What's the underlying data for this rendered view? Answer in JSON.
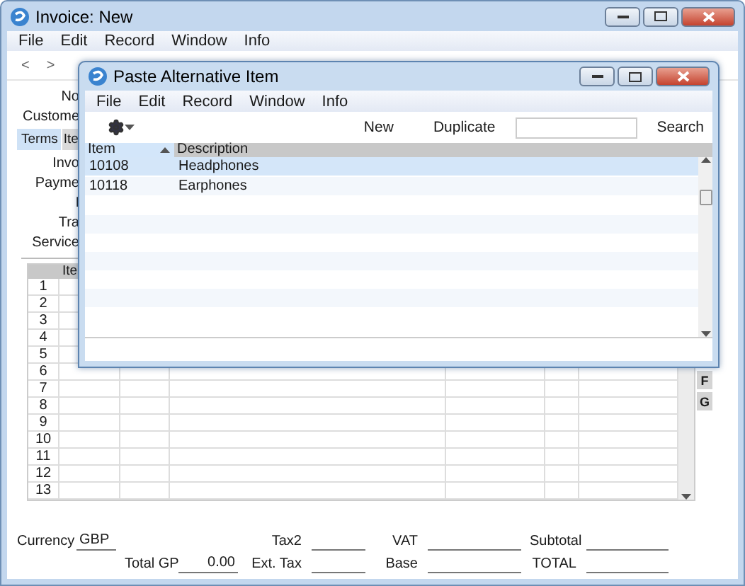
{
  "main_window": {
    "title": "Invoice: New",
    "menu": [
      "File",
      "Edit",
      "Record",
      "Window",
      "Info"
    ],
    "nav_buttons": [
      "<",
      ">"
    ],
    "header_labels": [
      "No",
      "Custome"
    ],
    "tabs": [
      {
        "label": "Terms",
        "selected": true
      },
      {
        "label": "Ite",
        "selected": false
      }
    ],
    "field_labels": [
      "Invo",
      "Payme",
      "I",
      "Tra",
      "Service"
    ],
    "grid": {
      "columns": [
        {
          "label": "Ite"
        }
      ],
      "row_numbers": [
        "1",
        "2",
        "3",
        "4",
        "5",
        "6",
        "7",
        "8",
        "9",
        "10",
        "11",
        "12",
        "13"
      ]
    },
    "side_buttons": [
      "F",
      "G"
    ],
    "footer": {
      "rows": [
        [
          {
            "label": "Currency",
            "value": "GBP"
          },
          {
            "label": "Tax2"
          },
          {
            "label": "VAT"
          },
          {
            "label": "Subtotal"
          }
        ],
        [
          {
            "label": "Total GP",
            "value": "0.00"
          },
          {
            "label": "Ext. Tax"
          },
          {
            "label": "Base"
          },
          {
            "label": "TOTAL"
          }
        ]
      ]
    }
  },
  "dialog": {
    "title": "Paste Alternative Item",
    "menu": [
      "File",
      "Edit",
      "Record",
      "Window",
      "Info"
    ],
    "toolbar": {
      "buttons": [
        "New",
        "Duplicate"
      ],
      "search_button": "Search"
    },
    "columns": [
      {
        "label": "Item",
        "sorted": true
      },
      {
        "label": "Description",
        "sorted": false
      }
    ],
    "rows": [
      {
        "item": "10108",
        "description": "Headphones",
        "selected": true
      },
      {
        "item": "10118",
        "description": "Earphones",
        "selected": false
      }
    ]
  }
}
